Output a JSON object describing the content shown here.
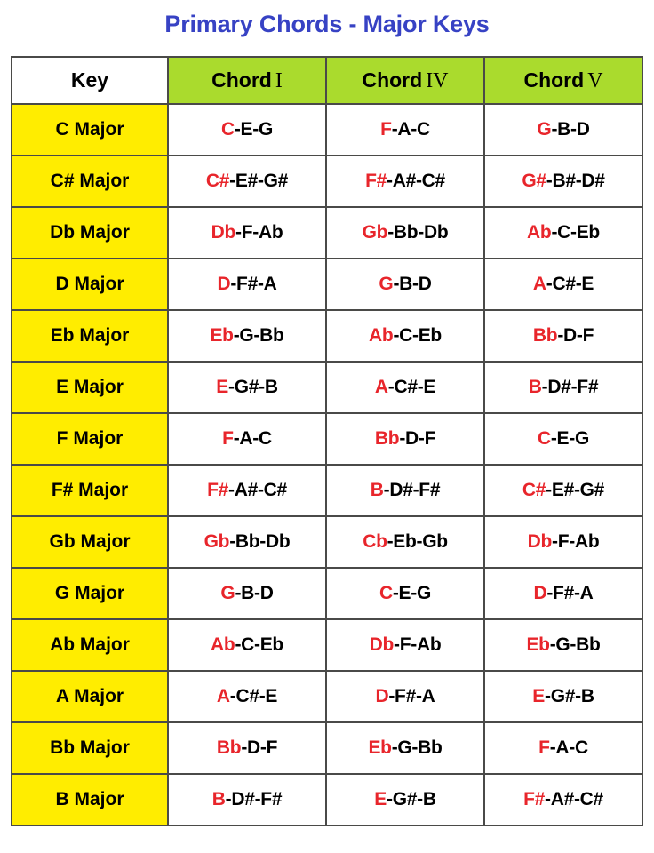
{
  "title": "Primary Chords - Major Keys",
  "colors": {
    "title_blue": "#3742c4",
    "header_green": "#aadb2d",
    "key_yellow": "#ffed00",
    "root_red": "#e8252b",
    "text_black": "#000000",
    "border_gray": "#4a4a48",
    "background": "#ffffff"
  },
  "table": {
    "headers": [
      {
        "label": "Key",
        "word": "Key",
        "numeral": "",
        "background": "#ffffff"
      },
      {
        "label": "Chord I",
        "word": "Chord",
        "numeral": "I",
        "background": "#aadb2d"
      },
      {
        "label": "Chord IV",
        "word": "Chord",
        "numeral": "IV",
        "background": "#aadb2d"
      },
      {
        "label": "Chord V",
        "word": "Chord",
        "numeral": "V",
        "background": "#aadb2d"
      }
    ],
    "rows": [
      {
        "key": "C Major",
        "chords": [
          {
            "root": "C",
            "rest": "-E-G"
          },
          {
            "root": "F",
            "rest": "-A-C"
          },
          {
            "root": "G",
            "rest": "-B-D"
          }
        ]
      },
      {
        "key": "C# Major",
        "chords": [
          {
            "root": "C#",
            "rest": "-E#-G#"
          },
          {
            "root": "F#",
            "rest": "-A#-C#"
          },
          {
            "root": "G#",
            "rest": "-B#-D#"
          }
        ]
      },
      {
        "key": "Db Major",
        "chords": [
          {
            "root": "Db",
            "rest": "-F-Ab"
          },
          {
            "root": "Gb",
            "rest": "-Bb-Db"
          },
          {
            "root": "Ab",
            "rest": "-C-Eb"
          }
        ]
      },
      {
        "key": "D Major",
        "chords": [
          {
            "root": "D",
            "rest": "-F#-A"
          },
          {
            "root": "G",
            "rest": "-B-D"
          },
          {
            "root": "A",
            "rest": "-C#-E"
          }
        ]
      },
      {
        "key": "Eb Major",
        "chords": [
          {
            "root": "Eb",
            "rest": "-G-Bb"
          },
          {
            "root": "Ab",
            "rest": "-C-Eb"
          },
          {
            "root": "Bb",
            "rest": "-D-F"
          }
        ]
      },
      {
        "key": "E Major",
        "chords": [
          {
            "root": "E",
            "rest": "-G#-B"
          },
          {
            "root": "A",
            "rest": "-C#-E"
          },
          {
            "root": "B",
            "rest": "-D#-F#"
          }
        ]
      },
      {
        "key": "F Major",
        "chords": [
          {
            "root": "F",
            "rest": "-A-C"
          },
          {
            "root": "Bb",
            "rest": "-D-F"
          },
          {
            "root": "C",
            "rest": "-E-G"
          }
        ]
      },
      {
        "key": "F# Major",
        "chords": [
          {
            "root": "F#",
            "rest": "-A#-C#"
          },
          {
            "root": "B",
            "rest": "-D#-F#"
          },
          {
            "root": "C#",
            "rest": "-E#-G#"
          }
        ]
      },
      {
        "key": "Gb Major",
        "chords": [
          {
            "root": "Gb",
            "rest": "-Bb-Db"
          },
          {
            "root": "Cb",
            "rest": "-Eb-Gb"
          },
          {
            "root": "Db",
            "rest": "-F-Ab"
          }
        ]
      },
      {
        "key": "G Major",
        "chords": [
          {
            "root": "G",
            "rest": "-B-D"
          },
          {
            "root": "C",
            "rest": "-E-G"
          },
          {
            "root": "D",
            "rest": "-F#-A"
          }
        ]
      },
      {
        "key": "Ab Major",
        "chords": [
          {
            "root": "Ab",
            "rest": "-C-Eb"
          },
          {
            "root": "Db",
            "rest": "-F-Ab"
          },
          {
            "root": "Eb",
            "rest": "-G-Bb"
          }
        ]
      },
      {
        "key": "A Major",
        "chords": [
          {
            "root": "A",
            "rest": "-C#-E"
          },
          {
            "root": "D",
            "rest": "-F#-A"
          },
          {
            "root": "E",
            "rest": "-G#-B"
          }
        ]
      },
      {
        "key": "Bb Major",
        "chords": [
          {
            "root": "Bb",
            "rest": "-D-F"
          },
          {
            "root": "Eb",
            "rest": "-G-Bb"
          },
          {
            "root": "F",
            "rest": "-A-C"
          }
        ]
      },
      {
        "key": "B Major",
        "chords": [
          {
            "root": "B",
            "rest": "-D#-F#"
          },
          {
            "root": "E",
            "rest": "-G#-B"
          },
          {
            "root": "F#",
            "rest": "-A#-C#"
          }
        ]
      }
    ]
  }
}
